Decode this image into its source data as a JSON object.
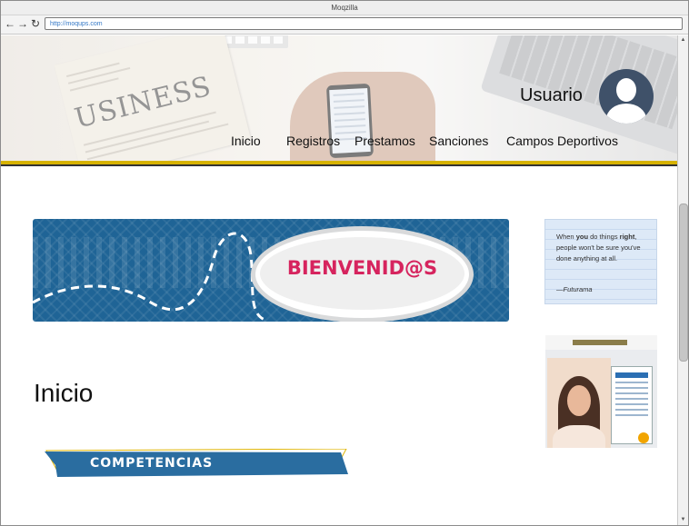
{
  "browser": {
    "window_title": "Moqzilla",
    "url": "http://moqups.com",
    "nav_icons": [
      "back-arrow-icon",
      "forward-arrow-icon",
      "reload-icon"
    ]
  },
  "header": {
    "user_label": "Usuario",
    "nav": [
      "Inicio",
      "Registros",
      "Prestamos",
      "Sanciones",
      "Campos Deportivos"
    ],
    "accent_color": "#d6b200"
  },
  "banner": {
    "text": "BIENVENID@S",
    "background": "#1f6496",
    "text_color": "#d6245e"
  },
  "quote": {
    "pre": "When",
    "b1": "you",
    "mid1": "do things",
    "b2": "right",
    "rest": ", people won't be sure you've done anything at all.",
    "author": "—Futurama"
  },
  "page": {
    "title": "Inicio",
    "section_label": "COMPETENCIAS",
    "section_color": "#2a6da0"
  }
}
